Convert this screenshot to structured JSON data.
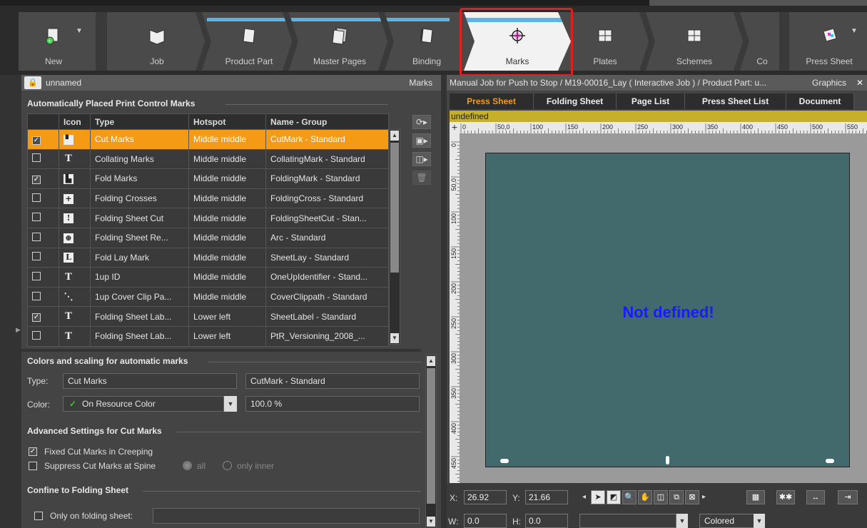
{
  "workflow": {
    "steps": [
      {
        "label": "New",
        "icon": "new-job-icon"
      },
      {
        "label": "Job",
        "icon": "job-icon"
      },
      {
        "label": "Product Part",
        "icon": "product-part-icon"
      },
      {
        "label": "Master Pages",
        "icon": "master-pages-icon"
      },
      {
        "label": "Binding",
        "icon": "binding-icon"
      },
      {
        "label": "Marks",
        "icon": "marks-icon"
      },
      {
        "label": "Plates",
        "icon": "plates-icon"
      },
      {
        "label": "Schemes",
        "icon": "schemes-icon"
      },
      {
        "label": "Co",
        "icon": ""
      },
      {
        "label": "Press Sheet",
        "icon": "press-sheet-icon"
      }
    ],
    "active": "Marks",
    "highlight_color": "#e02020",
    "accent_color": "#5ab4e8"
  },
  "left_panel": {
    "title": "unnamed",
    "right_label": "Marks",
    "auto_section_title": "Automatically Placed Print Control Marks",
    "table": {
      "columns": [
        "",
        "Icon",
        "Type",
        "Hotspot",
        "Name - Group"
      ],
      "rows": [
        {
          "checked": true,
          "icon": "cut-mark",
          "type": "Cut Marks",
          "hotspot": "Middle middle",
          "name": "CutMark - Standard",
          "selected": true
        },
        {
          "checked": false,
          "icon": "T",
          "type": "Collating Marks",
          "hotspot": "Middle middle",
          "name": "CollatingMark - Standard"
        },
        {
          "checked": true,
          "icon": "fold-mark",
          "type": "Fold Marks",
          "hotspot": "Middle middle",
          "name": "FoldingMark - Standard"
        },
        {
          "checked": false,
          "icon": "+",
          "type": "Folding Crosses",
          "hotspot": "Middle middle",
          "name": "FoldingCross - Standard"
        },
        {
          "checked": false,
          "icon": "!",
          "type": "Folding Sheet Cut",
          "hotspot": "Middle middle",
          "name": "FoldingSheetCut - Stan..."
        },
        {
          "checked": false,
          "icon": "⊕",
          "type": "Folding Sheet Re...",
          "hotspot": "Middle middle",
          "name": "Arc - Standard"
        },
        {
          "checked": false,
          "icon": "L",
          "type": "Fold Lay Mark",
          "hotspot": "Middle middle",
          "name": "SheetLay - Standard"
        },
        {
          "checked": false,
          "icon": "T",
          "type": "1up ID",
          "hotspot": "Middle middle",
          "name": "OneUpIdentifier - Stand..."
        },
        {
          "checked": false,
          "icon": "✎",
          "type": "1up Cover Clip Pa...",
          "hotspot": "Middle middle",
          "name": "CoverClippath - Standard"
        },
        {
          "checked": true,
          "icon": "T",
          "type": "Folding Sheet Lab...",
          "hotspot": "Lower left",
          "name": "SheetLabel - Standard"
        },
        {
          "checked": false,
          "icon": "T",
          "type": "Folding Sheet Lab...",
          "hotspot": "Lower left",
          "name": "PtR_Versioning_2008_..."
        }
      ]
    },
    "colors_section_title": "Colors and scaling for automatic marks",
    "type_label": "Type:",
    "type_value": "Cut Marks",
    "type_group_value": "CutMark - Standard",
    "color_label": "Color:",
    "color_value": "On Resource Color",
    "scale_value": "100.0 %",
    "advanced_title": "Advanced Settings for Cut Marks",
    "fixed_cut_label": "Fixed Cut Marks in Creeping",
    "fixed_cut_checked": true,
    "suppress_label": "Suppress Cut Marks at Spine",
    "suppress_checked": false,
    "radio_all": "all",
    "radio_inner": "only inner",
    "confine_title": "Confine to Folding Sheet",
    "only_on_label": "Only on folding sheet:",
    "only_on_value": ""
  },
  "right_panel": {
    "title": "Manual Job for Push to Stop / M19-00016_Lay ( Interactive Job ) / Product Part: u...",
    "title_right": "Graphics",
    "tabs": [
      "Press Sheet",
      "Folding Sheet",
      "Page List",
      "Press Sheet List",
      "Document"
    ],
    "active_tab": "Press Sheet",
    "undefined_label": "undefined",
    "ruler_ticks": [
      "0",
      "50,0",
      "100",
      "150",
      "200",
      "250",
      "300",
      "350",
      "400",
      "450",
      "500",
      "550"
    ],
    "vruler_ticks": [
      "0",
      "50,0",
      "100",
      "150",
      "200",
      "250",
      "300",
      "350",
      "400",
      "450"
    ],
    "canvas_message": "Not defined!",
    "sheet_color": "#426a6d",
    "x_label": "X:",
    "x_value": "26.92",
    "y_label": "Y:",
    "y_value": "21.66",
    "w_label": "W:",
    "w_value": "0.0",
    "h_label": "H:",
    "h_value": "0.0",
    "view_mode": "Colored"
  }
}
